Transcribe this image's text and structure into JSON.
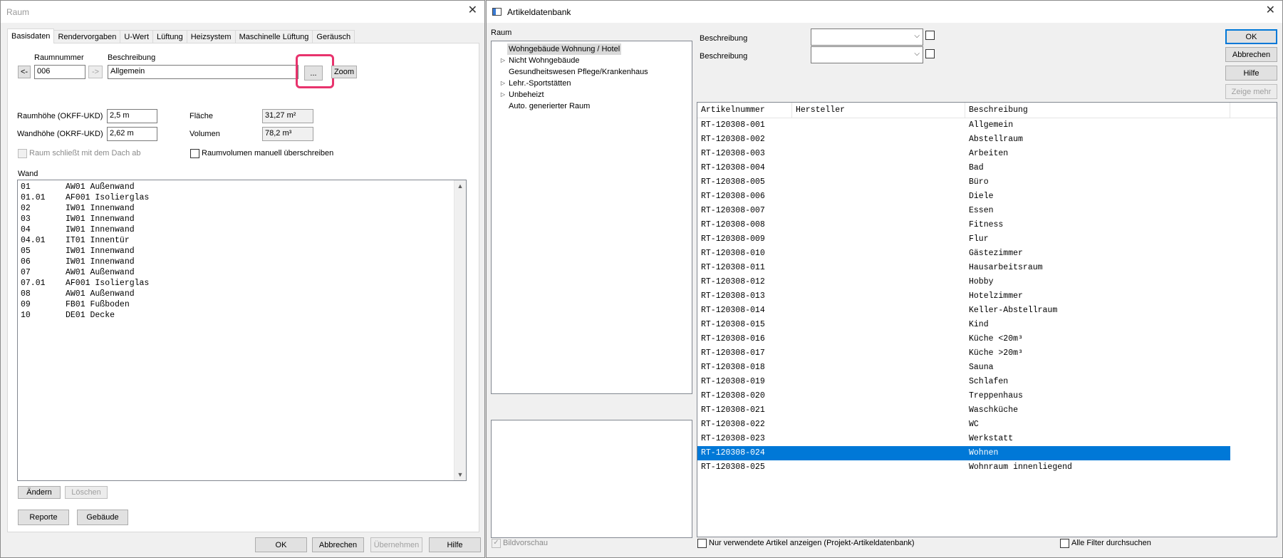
{
  "raum": {
    "title": "Raum",
    "tabs": [
      "Basisdaten",
      "Rendervorgaben",
      "U-Wert",
      "Lüftung",
      "Heizsystem",
      "Maschinelle Lüftung",
      "Geräusch"
    ],
    "raumnummer_label": "Raumnummer",
    "beschreibung_label": "Beschreibung",
    "prev_label": "<-",
    "next_label": "->",
    "raumnummer_value": "006",
    "beschreibung_value": "Allgemein",
    "browse_label": "...",
    "zoom_label": "Zoom",
    "raumhoehe_label": "Raumhöhe (OKFF-UKD)",
    "raumhoehe_value": "2,5 m",
    "wandhoehe_label": "Wandhöhe (OKRF-UKD)",
    "wandhoehe_value": "2,62 m",
    "flaeche_label": "Fläche",
    "flaeche_value": "31,27 m²",
    "volumen_label": "Volumen",
    "volumen_value": "78,2 m³",
    "dach_label": "Raum schließt mit dem Dach ab",
    "volumen_manuell_label": "Raumvolumen manuell überschreiben",
    "wand_label": "Wand",
    "walls": [
      {
        "nr": "01",
        "name": "AW01 Außenwand"
      },
      {
        "nr": "01.01",
        "name": "AF001 Isolierglas"
      },
      {
        "nr": "02",
        "name": "IW01 Innenwand"
      },
      {
        "nr": "03",
        "name": "IW01 Innenwand"
      },
      {
        "nr": "04",
        "name": "IW01 Innenwand"
      },
      {
        "nr": "04.01",
        "name": "IT01 Innentür"
      },
      {
        "nr": "05",
        "name": "IW01 Innenwand"
      },
      {
        "nr": "06",
        "name": "IW01 Innenwand"
      },
      {
        "nr": "07",
        "name": "AW01 Außenwand"
      },
      {
        "nr": "07.01",
        "name": "AF001 Isolierglas"
      },
      {
        "nr": "08",
        "name": "AW01 Außenwand"
      },
      {
        "nr": "09",
        "name": "FB01 Fußboden"
      },
      {
        "nr": "10",
        "name": "DE01 Decke"
      }
    ],
    "aendern_label": "Ändern",
    "loeschen_label": "Löschen",
    "reporte_label": "Reporte",
    "gebaeude_label": "Gebäude",
    "ok_label": "OK",
    "abbrechen_label": "Abbrechen",
    "uebernehmen_label": "Übernehmen",
    "hilfe_label": "Hilfe"
  },
  "artikel": {
    "title": "Artikeldatenbank",
    "raum_label": "Raum",
    "tree": [
      {
        "label": "Wohngebäude Wohnung / Hotel",
        "expandable": false,
        "selected": true
      },
      {
        "label": "Nicht Wohngebäude",
        "expandable": true,
        "selected": false
      },
      {
        "label": "Gesundheitswesen Pflege/Krankenhaus",
        "expandable": false,
        "selected": false
      },
      {
        "label": "Lehr.-Sportstätten",
        "expandable": true,
        "selected": false
      },
      {
        "label": "Unbeheizt",
        "expandable": true,
        "selected": false
      },
      {
        "label": "Auto. generierter Raum",
        "expandable": false,
        "selected": false
      }
    ],
    "filter1_label": "Beschreibung",
    "filter2_label": "Beschreibung",
    "ok_label": "OK",
    "abbrechen_label": "Abbrechen",
    "hilfe_label": "Hilfe",
    "zeige_mehr_label": "Zeige mehr",
    "columns": [
      "Artikelnummer",
      "Hersteller",
      "Beschreibung"
    ],
    "rows": [
      {
        "nr": "RT-120308-001",
        "hersteller": "",
        "beschreibung": "Allgemein"
      },
      {
        "nr": "RT-120308-002",
        "hersteller": "",
        "beschreibung": "Abstellraum"
      },
      {
        "nr": "RT-120308-003",
        "hersteller": "",
        "beschreibung": "Arbeiten"
      },
      {
        "nr": "RT-120308-004",
        "hersteller": "",
        "beschreibung": "Bad"
      },
      {
        "nr": "RT-120308-005",
        "hersteller": "",
        "beschreibung": "Büro"
      },
      {
        "nr": "RT-120308-006",
        "hersteller": "",
        "beschreibung": "Diele"
      },
      {
        "nr": "RT-120308-007",
        "hersteller": "",
        "beschreibung": "Essen"
      },
      {
        "nr": "RT-120308-008",
        "hersteller": "",
        "beschreibung": "Fitness"
      },
      {
        "nr": "RT-120308-009",
        "hersteller": "",
        "beschreibung": "Flur"
      },
      {
        "nr": "RT-120308-010",
        "hersteller": "",
        "beschreibung": "Gästezimmer"
      },
      {
        "nr": "RT-120308-011",
        "hersteller": "",
        "beschreibung": "Hausarbeitsraum"
      },
      {
        "nr": "RT-120308-012",
        "hersteller": "",
        "beschreibung": "Hobby"
      },
      {
        "nr": "RT-120308-013",
        "hersteller": "",
        "beschreibung": "Hotelzimmer"
      },
      {
        "nr": "RT-120308-014",
        "hersteller": "",
        "beschreibung": "Keller-Abstellraum"
      },
      {
        "nr": "RT-120308-015",
        "hersteller": "",
        "beschreibung": "Kind"
      },
      {
        "nr": "RT-120308-016",
        "hersteller": "",
        "beschreibung": "Küche <20m³"
      },
      {
        "nr": "RT-120308-017",
        "hersteller": "",
        "beschreibung": "Küche >20m³"
      },
      {
        "nr": "RT-120308-018",
        "hersteller": "",
        "beschreibung": "Sauna"
      },
      {
        "nr": "RT-120308-019",
        "hersteller": "",
        "beschreibung": "Schlafen"
      },
      {
        "nr": "RT-120308-020",
        "hersteller": "",
        "beschreibung": "Treppenhaus"
      },
      {
        "nr": "RT-120308-021",
        "hersteller": "",
        "beschreibung": "Waschküche"
      },
      {
        "nr": "RT-120308-022",
        "hersteller": "",
        "beschreibung": "WC"
      },
      {
        "nr": "RT-120308-023",
        "hersteller": "",
        "beschreibung": "Werkstatt"
      },
      {
        "nr": "RT-120308-024",
        "hersteller": "",
        "beschreibung": "Wohnen",
        "selected": true
      },
      {
        "nr": "RT-120308-025",
        "hersteller": "",
        "beschreibung": "Wohnraum innenliegend"
      }
    ],
    "bildvorschau_label": "Bildvorschau",
    "nur_verwendete_label": "Nur verwendete Artikel anzeigen (Projekt-Artikeldatenbank)",
    "alle_filter_label": "Alle Filter durchsuchen"
  },
  "colors": {
    "selection": "#0078d7",
    "highlight_border": "#e8336d"
  }
}
